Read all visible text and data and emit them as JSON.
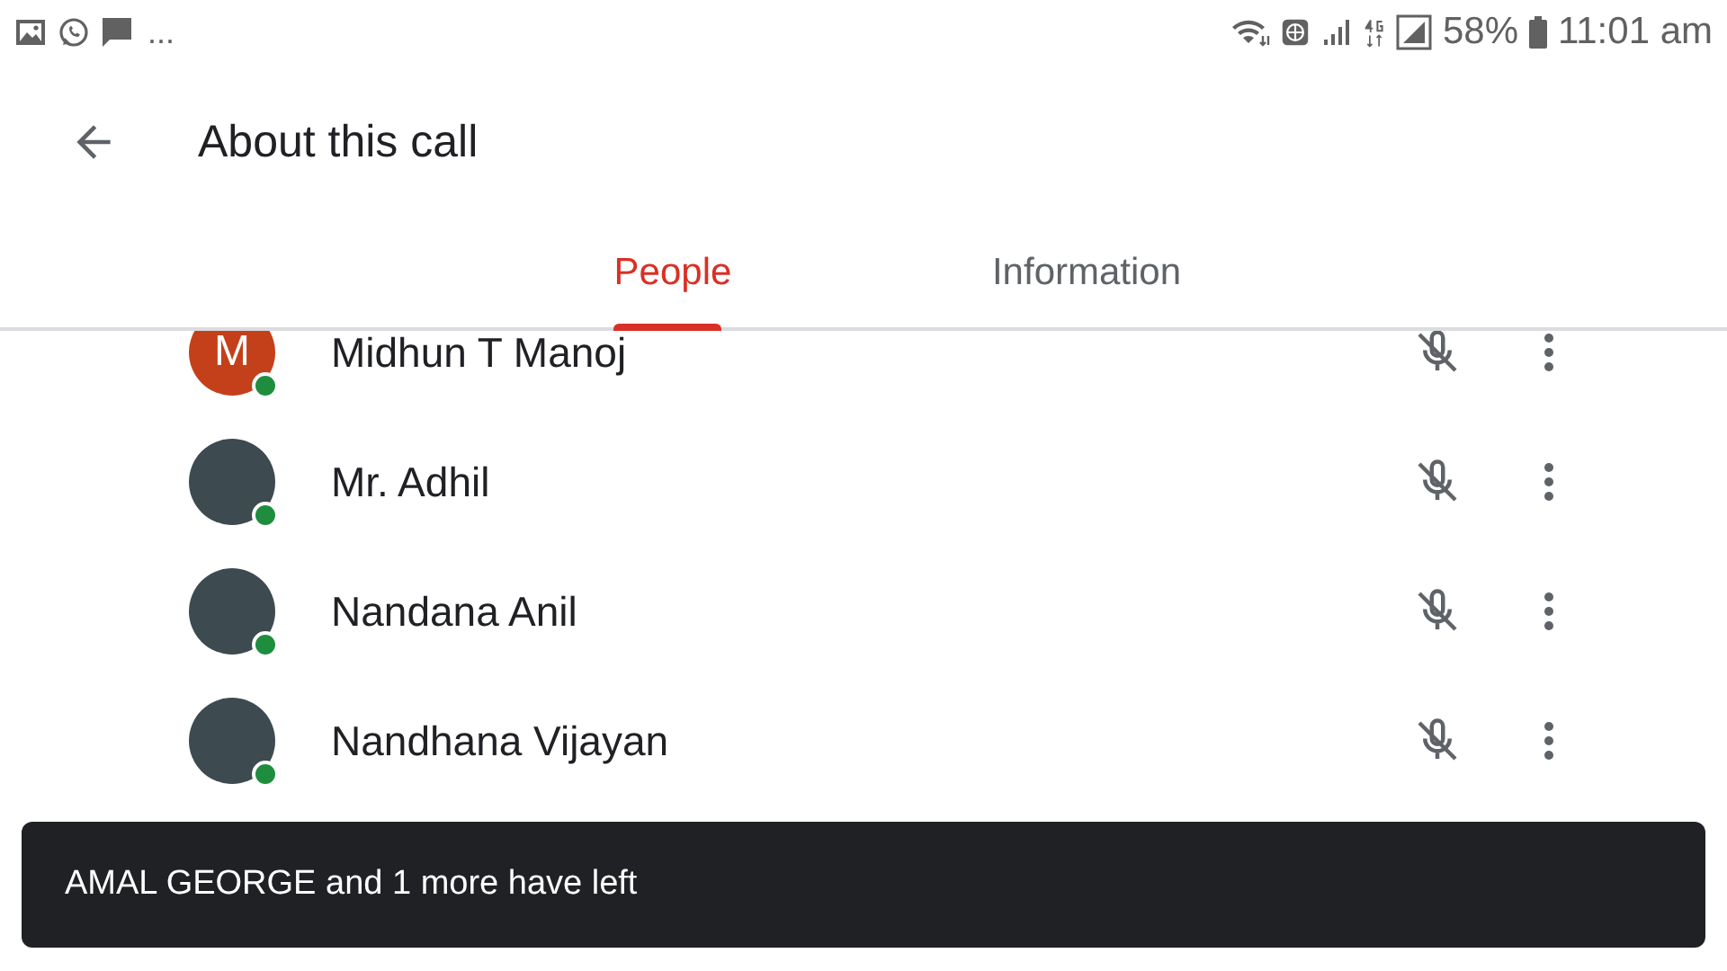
{
  "status_bar": {
    "notifications": "...",
    "battery": "58%",
    "time": "11:01 am"
  },
  "app_bar": {
    "title": "About this call"
  },
  "tabs": [
    {
      "label": "People",
      "selected": true
    },
    {
      "label": "Information",
      "selected": false
    }
  ],
  "people": [
    {
      "name": "Midhun T Manoj",
      "avatar": {
        "kind": "letter",
        "letter": "M",
        "color": "#c4401a"
      },
      "online": true,
      "muted": true
    },
    {
      "name": "Mr. Adhil",
      "avatar": {
        "kind": "photo"
      },
      "online": true,
      "muted": true
    },
    {
      "name": "Nandana Anil",
      "avatar": {
        "kind": "photo"
      },
      "online": true,
      "muted": true
    },
    {
      "name": "Nandhana Vijayan",
      "avatar": {
        "kind": "photo"
      },
      "online": true,
      "muted": true
    }
  ],
  "snackbar": {
    "message": "AMAL GEORGE and 1 more have left"
  }
}
